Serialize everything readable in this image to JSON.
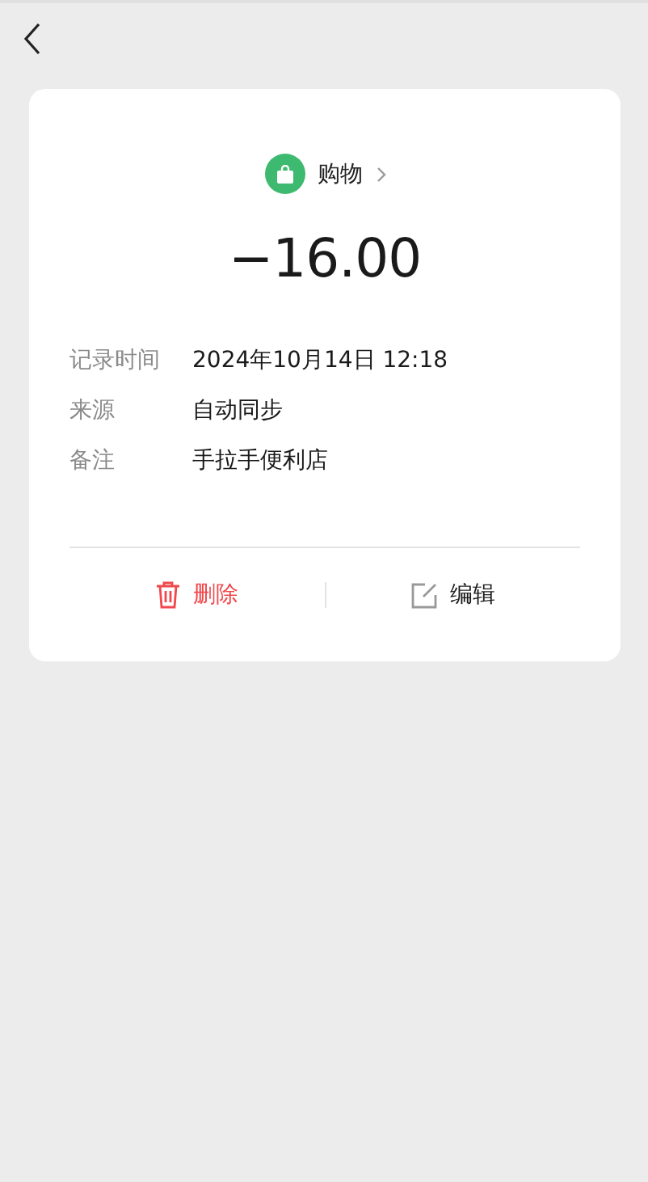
{
  "category": {
    "label": "购物",
    "color": "#3dba6f"
  },
  "amount": "−16.00",
  "details": [
    {
      "label": "记录时间",
      "value": "2024年10月14日 12:18"
    },
    {
      "label": "来源",
      "value": "自动同步"
    },
    {
      "label": "备注",
      "value": "手拉手便利店"
    }
  ],
  "actions": [
    {
      "kind": "delete",
      "label": "删除"
    },
    {
      "kind": "edit",
      "label": "编辑"
    }
  ]
}
